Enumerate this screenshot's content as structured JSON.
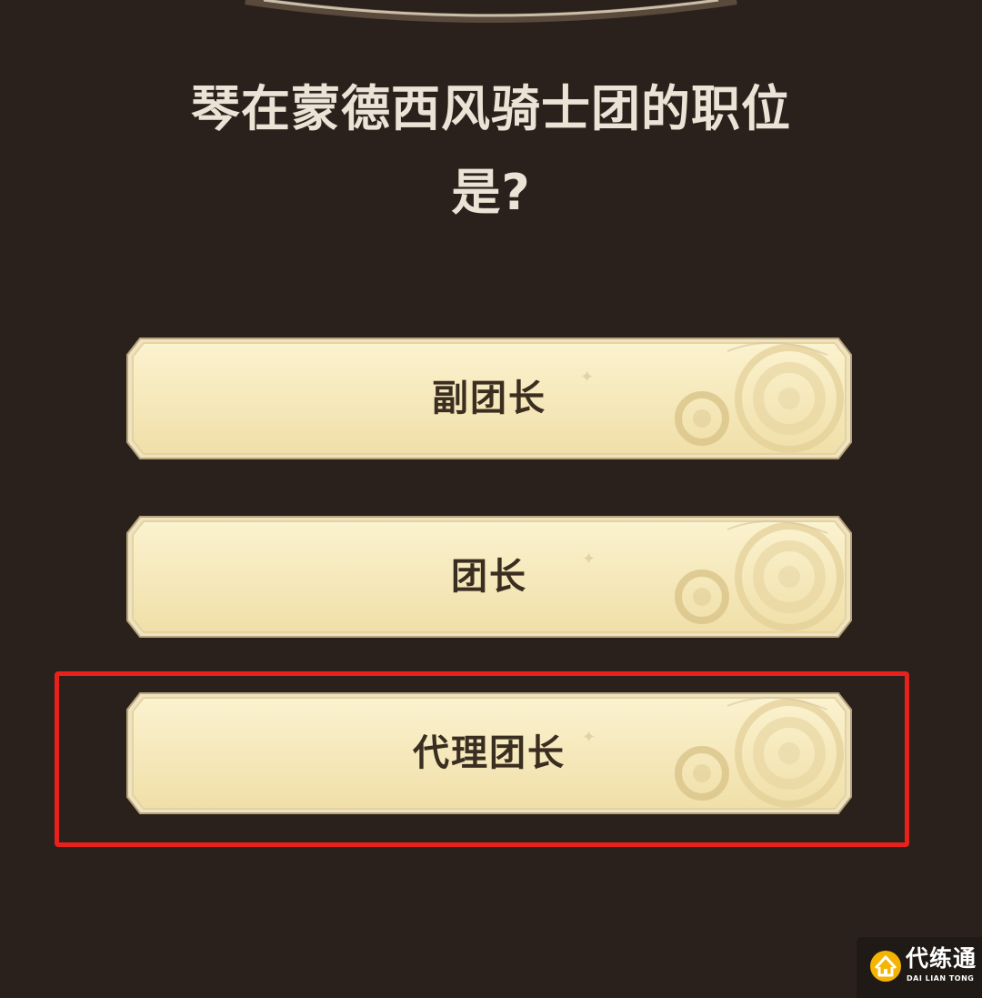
{
  "quiz": {
    "question_line1": "琴在蒙德西风骑士团的职位",
    "question_line2": "是?",
    "options": [
      {
        "label": "副团长"
      },
      {
        "label": "团长"
      },
      {
        "label": "代理团长",
        "highlighted": true
      }
    ]
  },
  "watermark": {
    "title": "代练通",
    "subtitle": "DAI LIAN TONG"
  },
  "colors": {
    "background": "#2b211c",
    "question_text": "#ebe3d6",
    "option_fill": "#f7ebc0",
    "option_border": "#d9c79a",
    "option_text": "#3a2e21",
    "highlight_border": "#e8221b",
    "watermark_accent": "#f5b400"
  },
  "icons": {
    "option_decoration": "gear-icon",
    "watermark_logo": "house-logo-icon"
  }
}
